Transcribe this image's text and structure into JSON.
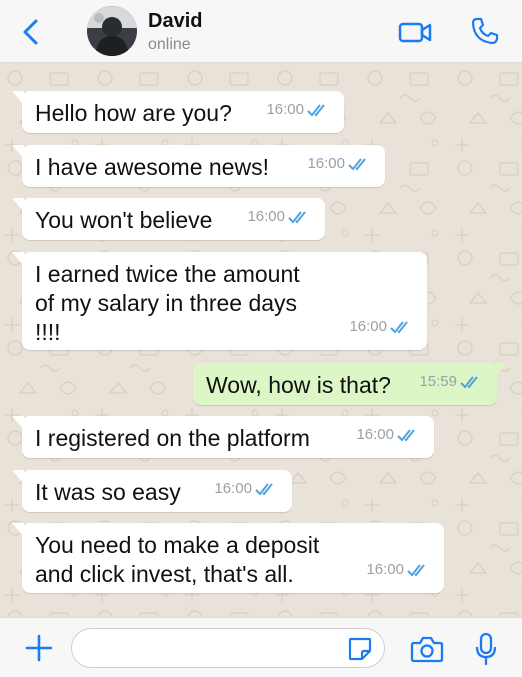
{
  "header": {
    "contact_name": "David",
    "status": "online"
  },
  "messages": [
    {
      "direction": "in",
      "text": "Hello how are you?",
      "time": "16:00"
    },
    {
      "direction": "in",
      "text": "I have awesome news!",
      "time": "16:00"
    },
    {
      "direction": "in",
      "text": "You won't believe",
      "time": "16:00"
    },
    {
      "direction": "in",
      "text": "I earned twice the amount\nof my salary in three days\n!!!!",
      "time": "16:00"
    },
    {
      "direction": "out",
      "text": "Wow, how is that?",
      "time": "15:59"
    },
    {
      "direction": "in",
      "text": "I registered on the platform",
      "time": "16:00"
    },
    {
      "direction": "in",
      "text": "It was so easy",
      "time": "16:00"
    },
    {
      "direction": "in",
      "text": "You need to make a deposit\nand click invest, that's all.",
      "time": "16:00"
    }
  ],
  "footer": {
    "input_value": "",
    "input_placeholder": ""
  },
  "icons": {
    "back": "chevron-left-icon",
    "video": "video-camera-icon",
    "call": "phone-icon",
    "plus": "plus-icon",
    "sticker": "sticker-icon",
    "camera": "camera-icon",
    "mic": "microphone-icon",
    "read": "double-check-icon"
  },
  "colors": {
    "accent": "#1a7cf0",
    "incoming_bubble": "#ffffff",
    "outgoing_bubble": "#dcf7c5",
    "read_receipt": "#4fa3e0",
    "wallpaper": "#e9e2d8"
  }
}
